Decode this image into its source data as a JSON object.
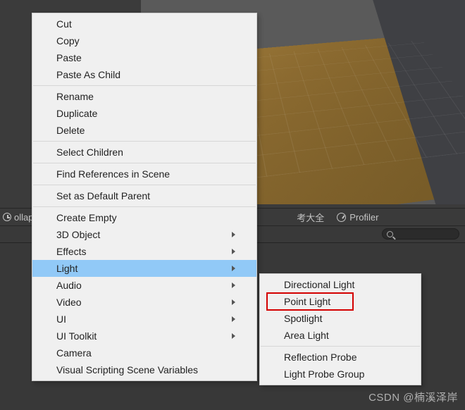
{
  "toolbar": {
    "collapse_label": "ollapse",
    "mid_text": "考大全",
    "profiler_label": "Profiler"
  },
  "context_menu": {
    "groups": [
      [
        "Cut",
        "Copy",
        "Paste",
        "Paste As Child"
      ],
      [
        "Rename",
        "Duplicate",
        "Delete"
      ],
      [
        "Select Children"
      ],
      [
        "Find References in Scene"
      ],
      [
        "Set as Default Parent"
      ]
    ],
    "create_group": [
      {
        "label": "Create Empty",
        "submenu": false
      },
      {
        "label": "3D Object",
        "submenu": true
      },
      {
        "label": "Effects",
        "submenu": true
      },
      {
        "label": "Light",
        "submenu": true,
        "hover": true
      },
      {
        "label": "Audio",
        "submenu": true
      },
      {
        "label": "Video",
        "submenu": true
      },
      {
        "label": "UI",
        "submenu": true
      },
      {
        "label": "UI Toolkit",
        "submenu": true
      },
      {
        "label": "Camera",
        "submenu": false
      },
      {
        "label": "Visual Scripting Scene Variables",
        "submenu": false
      }
    ]
  },
  "light_submenu": {
    "groups": [
      [
        "Directional Light",
        "Point Light",
        "Spotlight",
        "Area Light"
      ],
      [
        "Reflection Probe",
        "Light Probe Group"
      ]
    ],
    "highlighted": "Point Light"
  },
  "watermark": "CSDN @楠溪泽岸"
}
